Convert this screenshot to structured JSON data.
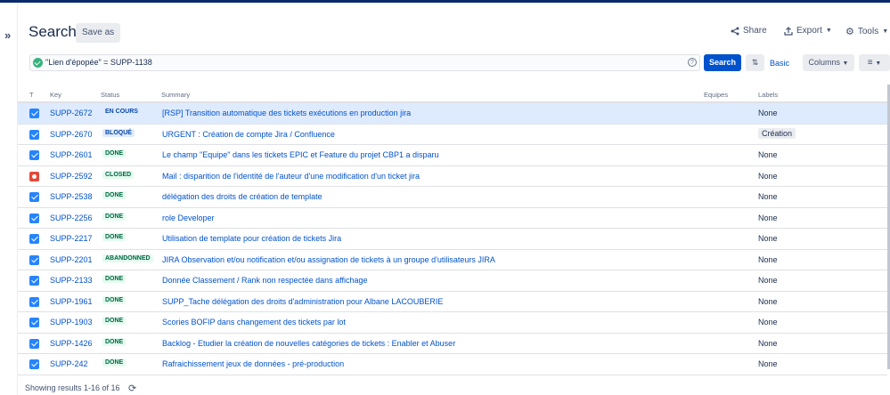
{
  "header": {
    "title": "Search",
    "save_as": "Save as",
    "share": "Share",
    "export": "Export",
    "tools": "Tools"
  },
  "query": {
    "text": "\"Lien d'épopée\" = SUPP-1138",
    "search_label": "Search",
    "basic_label": "Basic",
    "columns_label": "Columns"
  },
  "table": {
    "columns": [
      "T",
      "Key",
      "Status",
      "Summary",
      "Equipes",
      "Labels"
    ],
    "rows": [
      {
        "type": "story",
        "key": "SUPP-2672",
        "status": "EN COURS",
        "summary": "[RSP] Transition automatique des tickets exécutions en production jira",
        "labels": "None"
      },
      {
        "type": "story",
        "key": "SUPP-2670",
        "status": "BLOQUÉ",
        "summary": "URGENT : Création de compte Jira / Confluence",
        "labels": "Création"
      },
      {
        "type": "story",
        "key": "SUPP-2601",
        "status": "DONE",
        "summary": "Le champ \"Equipe\" dans les tickets EPIC et Feature du projet CBP1 a disparu",
        "labels": "None"
      },
      {
        "type": "bug",
        "key": "SUPP-2592",
        "status": "CLOSED",
        "summary": "Mail : disparition de l'identité de l'auteur d'une modification d'un ticket jira",
        "labels": "None"
      },
      {
        "type": "story",
        "key": "SUPP-2538",
        "status": "DONE",
        "summary": "délégation des droits de création de template",
        "labels": "None"
      },
      {
        "type": "story",
        "key": "SUPP-2256",
        "status": "DONE",
        "summary": "role Developer",
        "labels": "None"
      },
      {
        "type": "story",
        "key": "SUPP-2217",
        "status": "DONE",
        "summary": "Utilisation de template pour création de tickets Jira",
        "labels": "None"
      },
      {
        "type": "story",
        "key": "SUPP-2201",
        "status": "ABANDONNED",
        "summary": "JIRA Observation et/ou notification et/ou assignation de tickets à un groupe d'utilisateurs JIRA",
        "labels": "None"
      },
      {
        "type": "story",
        "key": "SUPP-2133",
        "status": "DONE",
        "summary": "Donnée Classement / Rank non respectée dans affichage",
        "labels": "None"
      },
      {
        "type": "story",
        "key": "SUPP-1961",
        "status": "DONE",
        "summary": "SUPP_Tache délégation des droits d'administration pour Albane LACOUBERIE",
        "labels": "None"
      },
      {
        "type": "story",
        "key": "SUPP-1903",
        "status": "DONE",
        "summary": "Scories BOFIP dans changement des tickets par lot",
        "labels": "None"
      },
      {
        "type": "story",
        "key": "SUPP-1426",
        "status": "DONE",
        "summary": "Backlog - Etudier la création de nouvelles catégories de tickets : Enabler et Abuser",
        "labels": "None"
      },
      {
        "type": "story",
        "key": "SUPP-242",
        "status": "DONE",
        "summary": "Rafraichissement jeux de données - pré-production",
        "labels": "None"
      }
    ]
  },
  "footer": {
    "results": "Showing results 1-16 of 16"
  }
}
